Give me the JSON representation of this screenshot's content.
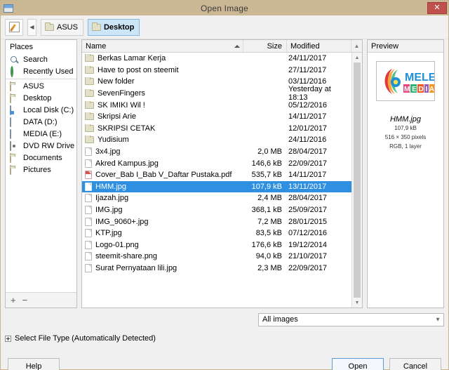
{
  "window": {
    "title": "Open Image",
    "app_icon": "image-app-icon",
    "close_label": "✕"
  },
  "toolbar": {
    "edit_icon": "pencil-edit-icon",
    "back_label": "◀",
    "breadcrumbs": [
      {
        "label": "ASUS",
        "active": false
      },
      {
        "label": "Desktop",
        "active": true
      }
    ]
  },
  "places": {
    "header": "Places",
    "items": [
      {
        "label": "Search",
        "icon": "search-icon",
        "sep": false
      },
      {
        "label": "Recently Used",
        "icon": "recent-clock-icon",
        "sep": false
      },
      {
        "label": "ASUS",
        "icon": "folder-icon",
        "sep": true
      },
      {
        "label": "Desktop",
        "icon": "folder-icon",
        "sep": false
      },
      {
        "label": "Local Disk (C:)",
        "icon": "system-drive-icon",
        "sep": false
      },
      {
        "label": "DATA (D:)",
        "icon": "drive-icon",
        "sep": false
      },
      {
        "label": "MEDIA (E:)",
        "icon": "drive-icon",
        "sep": false
      },
      {
        "label": "DVD RW Drive (F:)",
        "icon": "dvd-drive-icon",
        "sep": false
      },
      {
        "label": "Documents",
        "icon": "folder-icon",
        "sep": false
      },
      {
        "label": "Pictures",
        "icon": "folder-icon",
        "sep": false
      }
    ],
    "add_label": "+",
    "remove_label": "−"
  },
  "filelist": {
    "columns": {
      "name": "Name",
      "size": "Size",
      "modified": "Modified"
    },
    "sort_column": "Name",
    "sort_direction": "ascending",
    "scroll_up": "▲",
    "scroll_down": "▼",
    "rows": [
      {
        "name": "Berkas Lamar Kerja",
        "size": "",
        "modified": "24/11/2017",
        "type": "folder",
        "selected": false
      },
      {
        "name": "Have to post on steemit",
        "size": "",
        "modified": "27/11/2017",
        "type": "folder",
        "selected": false
      },
      {
        "name": "New folder",
        "size": "",
        "modified": "03/11/2016",
        "type": "folder",
        "selected": false
      },
      {
        "name": "SevenFingers",
        "size": "",
        "modified": "Yesterday at 18:13",
        "type": "folder",
        "selected": false
      },
      {
        "name": "SK IMIKI Wil !",
        "size": "",
        "modified": "05/12/2016",
        "type": "folder",
        "selected": false
      },
      {
        "name": "Skripsi Arie",
        "size": "",
        "modified": "14/11/2017",
        "type": "folder",
        "selected": false
      },
      {
        "name": "SKRIPSI CETAK",
        "size": "",
        "modified": "12/01/2017",
        "type": "folder",
        "selected": false
      },
      {
        "name": "Yudisium",
        "size": "",
        "modified": "24/11/2016",
        "type": "folder",
        "selected": false
      },
      {
        "name": "3x4.jpg",
        "size": "2,0 MB",
        "modified": "28/04/2017",
        "type": "file",
        "selected": false
      },
      {
        "name": "Akred Kampus.jpg",
        "size": "146,6 kB",
        "modified": "22/09/2017",
        "type": "file",
        "selected": false
      },
      {
        "name": "Cover_Bab I_Bab V_Daftar Pustaka.pdf",
        "size": "535,7 kB",
        "modified": "14/11/2017",
        "type": "pdf",
        "selected": false
      },
      {
        "name": "HMM.jpg",
        "size": "107,9 kB",
        "modified": "13/11/2017",
        "type": "file",
        "selected": true
      },
      {
        "name": "Ijazah.jpg",
        "size": "2,4 MB",
        "modified": "28/04/2017",
        "type": "file",
        "selected": false
      },
      {
        "name": "IMG.jpg",
        "size": "368,1 kB",
        "modified": "25/09/2017",
        "type": "file",
        "selected": false
      },
      {
        "name": "IMG_9060+.jpg",
        "size": "7,2 MB",
        "modified": "28/01/2015",
        "type": "file",
        "selected": false
      },
      {
        "name": "KTP.jpg",
        "size": "83,5 kB",
        "modified": "07/12/2016",
        "type": "file",
        "selected": false
      },
      {
        "name": "Logo-01.png",
        "size": "176,6 kB",
        "modified": "19/12/2014",
        "type": "file",
        "selected": false
      },
      {
        "name": "steemit-share.png",
        "size": "94,0 kB",
        "modified": "21/10/2017",
        "type": "file",
        "selected": false
      },
      {
        "name": "Surat Pernyataan lili.jpg",
        "size": "2,3 MB",
        "modified": "22/09/2017",
        "type": "file",
        "selected": false
      }
    ]
  },
  "preview": {
    "header": "Preview",
    "thumbnail_alt": "melek-media-logo",
    "logo": {
      "line1": "MELEK",
      "line2_letters": [
        "M",
        "E",
        "D",
        "I",
        "A"
      ],
      "line1_color": "#1f8fd6",
      "line2_colors": [
        "#e8467c",
        "#2bb673",
        "#f15a24",
        "#9b59b6",
        "#f7941e"
      ]
    },
    "filename": "HMM.jpg",
    "filesize": "107,9 kB",
    "dimensions": "516 × 350 pixels",
    "colormode": "RGB, 1 layer"
  },
  "footer": {
    "filetype_value": "All images",
    "filetype_chevron": "▼",
    "expander_label": "Select File Type (Automatically Detected)",
    "help_label": "Help",
    "open_label": "Open",
    "cancel_label": "Cancel"
  }
}
